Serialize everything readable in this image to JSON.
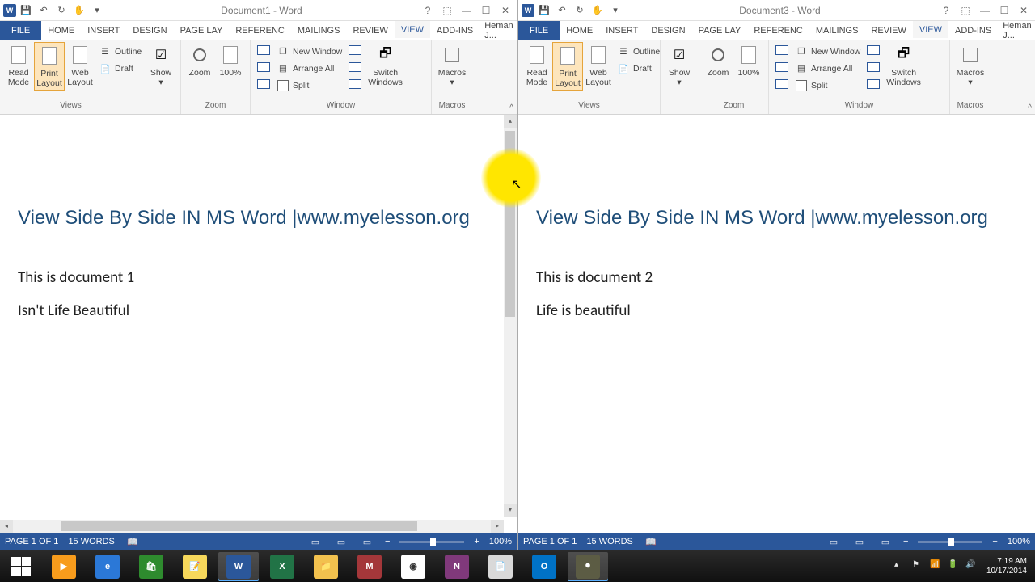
{
  "left": {
    "title": "Document1 - Word",
    "user": "Heman J...",
    "tabs": {
      "file": "FILE",
      "home": "HOME",
      "insert": "INSERT",
      "design": "DESIGN",
      "pagelay": "PAGE LAY",
      "referenc": "REFERENC",
      "mailings": "MAILINGS",
      "review": "REVIEW",
      "view": "VIEW",
      "addins": "ADD-INS"
    },
    "ribbon": {
      "views": "Views",
      "zoom": "Zoom",
      "window": "Window",
      "macros": "Macros",
      "read_mode": "Read\nMode",
      "print_layout": "Print\nLayout",
      "web_layout": "Web\nLayout",
      "outline": "Outline",
      "draft": "Draft",
      "show": "Show",
      "zoombtn": "Zoom",
      "hundred": "100%",
      "new_window": "New Window",
      "arrange_all": "Arrange All",
      "split": "Split",
      "switch_windows": "Switch\nWindows",
      "macrosbtn": "Macros"
    },
    "doc": {
      "heading": "View Side By Side IN MS Word |www.myelesson.org",
      "line1": "This is document 1",
      "line2": "Isn't Life Beautiful"
    },
    "status": {
      "page": "PAGE 1 OF 1",
      "words": "15 WORDS",
      "zoom": "100%"
    }
  },
  "right": {
    "title": "Document3 - Word",
    "user": "Heman J...",
    "tabs": {
      "file": "FILE",
      "home": "HOME",
      "insert": "INSERT",
      "design": "DESIGN",
      "pagelay": "PAGE LAY",
      "referenc": "REFERENC",
      "mailings": "MAILINGS",
      "review": "REVIEW",
      "view": "VIEW",
      "addins": "ADD-INS"
    },
    "ribbon": {
      "views": "Views",
      "zoom": "Zoom",
      "window": "Window",
      "macros": "Macros",
      "read_mode": "Read\nMode",
      "print_layout": "Print\nLayout",
      "web_layout": "Web\nLayout",
      "outline": "Outline",
      "draft": "Draft",
      "show": "Show",
      "zoombtn": "Zoom",
      "hundred": "100%",
      "new_window": "New Window",
      "arrange_all": "Arrange All",
      "split": "Split",
      "switch_windows": "Switch\nWindows",
      "macrosbtn": "Macros"
    },
    "doc": {
      "heading": "View Side By Side IN MS Word |www.myelesson.org",
      "line1": "This is document 2",
      "line2": "Life is beautiful"
    },
    "status": {
      "page": "PAGE 1 OF 1",
      "words": "15 WORDS",
      "zoom": "100%"
    }
  },
  "taskbar": {
    "time": "7:19 AM",
    "date": "10/17/2014"
  }
}
